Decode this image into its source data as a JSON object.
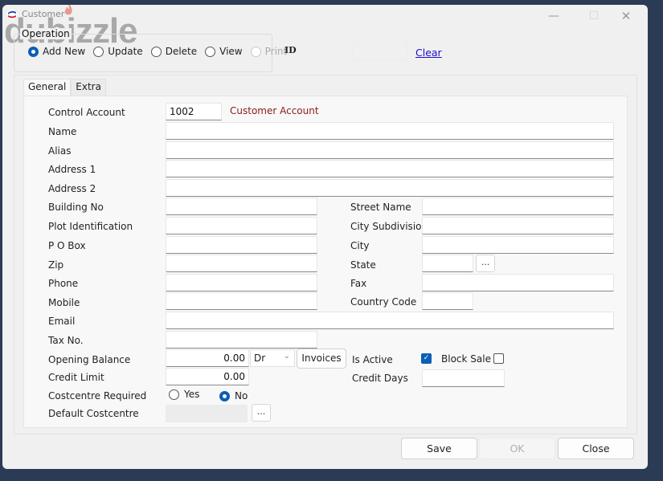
{
  "window": {
    "title": "Customer",
    "watermark": "dubizzle",
    "controls": {
      "minimize": "—",
      "maximize": "☐",
      "close": "✕"
    }
  },
  "operation": {
    "legend": "Operation",
    "options": [
      {
        "label": "Add New",
        "selected": true,
        "enabled": true
      },
      {
        "label": "Update",
        "selected": false,
        "enabled": true
      },
      {
        "label": "Delete",
        "selected": false,
        "enabled": true
      },
      {
        "label": "View",
        "selected": false,
        "enabled": true
      },
      {
        "label": "Print",
        "selected": false,
        "enabled": false
      }
    ],
    "id_label": "ID",
    "id_value": "",
    "clear_link": "Clear"
  },
  "tabs": [
    {
      "label": "General",
      "active": true
    },
    {
      "label": "Extra",
      "active": false
    }
  ],
  "form": {
    "control_account": {
      "label": "Control Account",
      "value": "1002",
      "account_name": "Customer Account"
    },
    "name": {
      "label": "Name",
      "value": ""
    },
    "alias": {
      "label": "Alias",
      "value": ""
    },
    "address1": {
      "label": "Address 1",
      "value": ""
    },
    "address2": {
      "label": "Address 2",
      "value": ""
    },
    "building_no": {
      "label": "Building No",
      "value": ""
    },
    "plot_identification": {
      "label": "Plot Identification",
      "value": ""
    },
    "po_box": {
      "label": "P O Box",
      "value": ""
    },
    "zip": {
      "label": "Zip",
      "value": ""
    },
    "phone": {
      "label": "Phone",
      "value": ""
    },
    "mobile": {
      "label": "Mobile",
      "value": ""
    },
    "email": {
      "label": "Email",
      "value": ""
    },
    "tax_no": {
      "label": "Tax No.",
      "value": ""
    },
    "street_name": {
      "label": "Street Name",
      "value": ""
    },
    "city_subdivision": {
      "label": "City Subdivision",
      "value": ""
    },
    "city": {
      "label": "City",
      "value": ""
    },
    "state": {
      "label": "State",
      "value": "",
      "browse": "..."
    },
    "fax": {
      "label": "Fax",
      "value": ""
    },
    "country_code": {
      "label": "Country Code",
      "value": ""
    },
    "opening_balance": {
      "label": "Opening Balance",
      "value": "0.00",
      "drcr": "Dr",
      "invoices_button": "Invoices"
    },
    "credit_limit": {
      "label": "Credit Limit",
      "value": "0.00"
    },
    "is_active": {
      "label": "Is Active",
      "checked": true
    },
    "block_sale": {
      "label": "Block Sale",
      "checked": false
    },
    "credit_days": {
      "label": "Credit Days",
      "value": ""
    },
    "costcentre_required": {
      "label": "Costcentre Required",
      "yes": "Yes",
      "no": "No",
      "selected": "No"
    },
    "default_costcentre": {
      "label": "Default Costcentre",
      "value": "",
      "browse": "..."
    }
  },
  "footer": {
    "save": "Save",
    "ok": "OK",
    "close": "Close"
  },
  "colors": {
    "accent": "#0a5fb4",
    "link": "#1a0dcc",
    "account_name": "#8b1a1a",
    "desktop": "#2b3a55"
  }
}
